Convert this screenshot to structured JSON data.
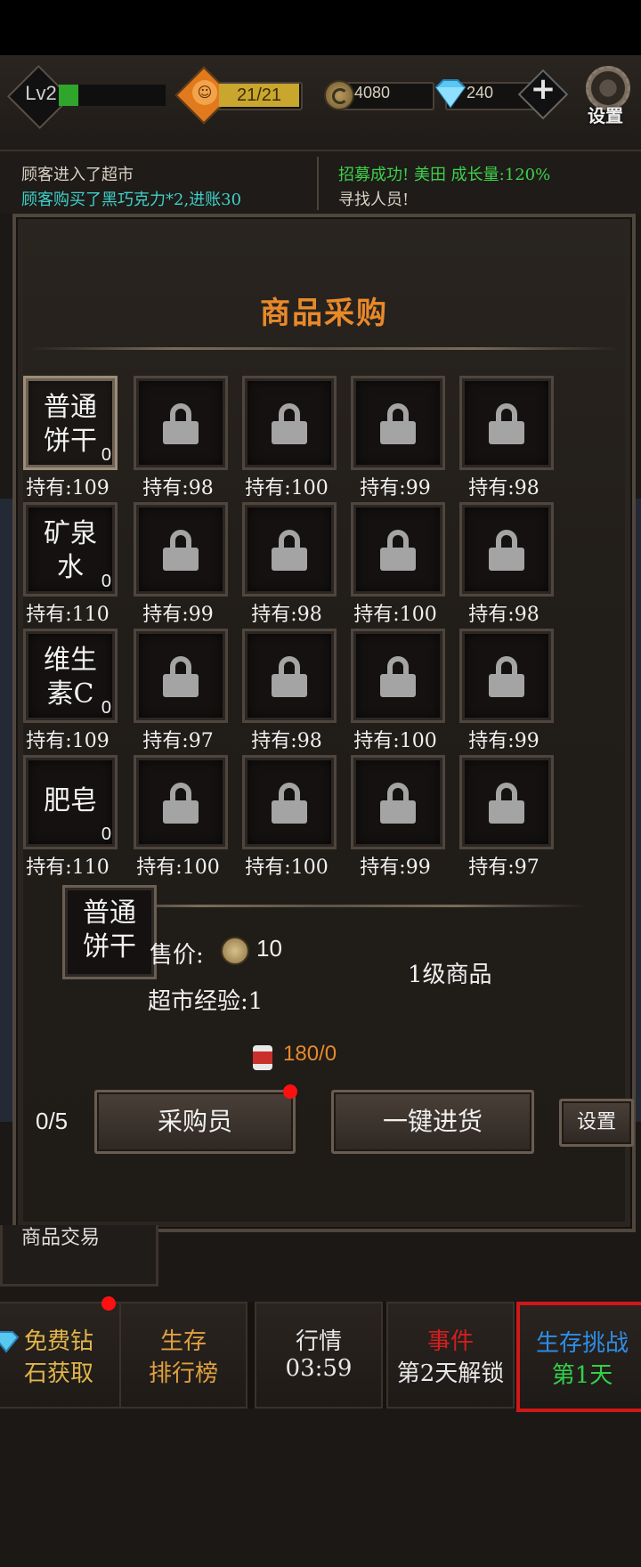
{
  "status_bar": {
    "level": "Lv2",
    "xp_fraction": 0.18,
    "stamina": "21/21",
    "gold": "4080",
    "gems": "240",
    "settings_label": "设置"
  },
  "log": {
    "left": [
      {
        "text": "顾客进入了超市",
        "color": "#d8d0c4"
      },
      {
        "text": "顾客购买了黑巧克力*2,进账30",
        "color": "#3fd0c8"
      }
    ],
    "right": [
      {
        "text": "招募成功! 美田 成长量:120%",
        "color": "#3fd04a"
      },
      {
        "text": "寻找人员!",
        "color": "#d8d0c4"
      }
    ]
  },
  "modal": {
    "title": "商品采购",
    "grid": [
      [
        {
          "name": "普通\n饼干",
          "count": "0",
          "held": "持有:109",
          "unlocked": true,
          "selected": true
        },
        {
          "held": "持有:98"
        },
        {
          "held": "持有:100"
        },
        {
          "held": "持有:99"
        },
        {
          "held": "持有:98"
        }
      ],
      [
        {
          "name": "矿泉\n水",
          "count": "0",
          "held": "持有:110",
          "unlocked": true
        },
        {
          "held": "持有:99"
        },
        {
          "held": "持有:98"
        },
        {
          "held": "持有:100"
        },
        {
          "held": "持有:98"
        }
      ],
      [
        {
          "name": "维生\n素C",
          "count": "0",
          "held": "持有:109",
          "unlocked": true
        },
        {
          "held": "持有:97"
        },
        {
          "held": "持有:98"
        },
        {
          "held": "持有:100"
        },
        {
          "held": "持有:99"
        }
      ],
      [
        {
          "name": "肥皂",
          "count": "0",
          "held": "持有:110",
          "unlocked": true
        },
        {
          "held": "持有:100"
        },
        {
          "held": "持有:100"
        },
        {
          "held": "持有:99"
        },
        {
          "held": "持有:97"
        }
      ]
    ],
    "detail": {
      "item_name": "普通\n饼干",
      "price_label": "售价:",
      "price_value": "10",
      "grade": "1级商品",
      "exp": "超市经验:1",
      "stock": "180/0"
    },
    "ratio": "0/5",
    "buyer_button": "采购员",
    "restock_button": "一键进货",
    "settings_button": "设置"
  },
  "behind": {
    "trade_label": "商品交易"
  },
  "bottom_nav": [
    {
      "line1": "免费钻",
      "line2": "石获取",
      "c1": "#e0b54a",
      "c2": "#e0b54a",
      "dot": true
    },
    {
      "line1": "生存",
      "line2": "排行榜",
      "c1": "#e0a040",
      "c2": "#e0a040"
    },
    {
      "line1": "行情",
      "line2": "03:59",
      "c1": "#e8e8e8",
      "c2": "#e8e8e8"
    },
    {
      "line1": "事件",
      "line2": "第2天解锁",
      "c1": "#d02020",
      "c2": "#e8e8e8"
    },
    {
      "line1": "生存挑战",
      "line2": "第1天",
      "c1": "#2e8ee8",
      "c2": "#33d04a",
      "active": true
    }
  ]
}
